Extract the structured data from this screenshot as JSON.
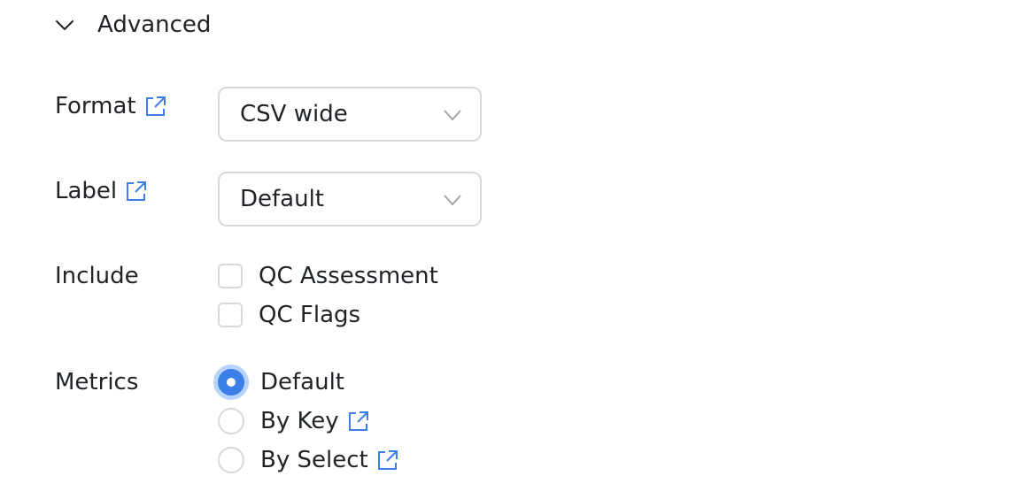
{
  "section": {
    "title": "Advanced",
    "expanded": true,
    "icon": "chevron-down-icon"
  },
  "format": {
    "label": "Format",
    "value": "CSV wide",
    "icon": "external-link-icon"
  },
  "label_field": {
    "label": "Label",
    "value": "Default",
    "icon": "external-link-icon"
  },
  "include": {
    "label": "Include",
    "options": [
      {
        "label": "QC Assessment",
        "checked": false
      },
      {
        "label": "QC Flags",
        "checked": false
      }
    ]
  },
  "metrics": {
    "label": "Metrics",
    "options": [
      {
        "label": "Default",
        "selected": true,
        "has_link": false
      },
      {
        "label": "By Key",
        "selected": false,
        "has_link": true
      },
      {
        "label": "By Select",
        "selected": false,
        "has_link": true
      }
    ]
  },
  "colors": {
    "accent": "#3d7fe8",
    "focus_ring": "#b9d4fb",
    "border": "#d7d9dc",
    "text": "#1f2328"
  }
}
